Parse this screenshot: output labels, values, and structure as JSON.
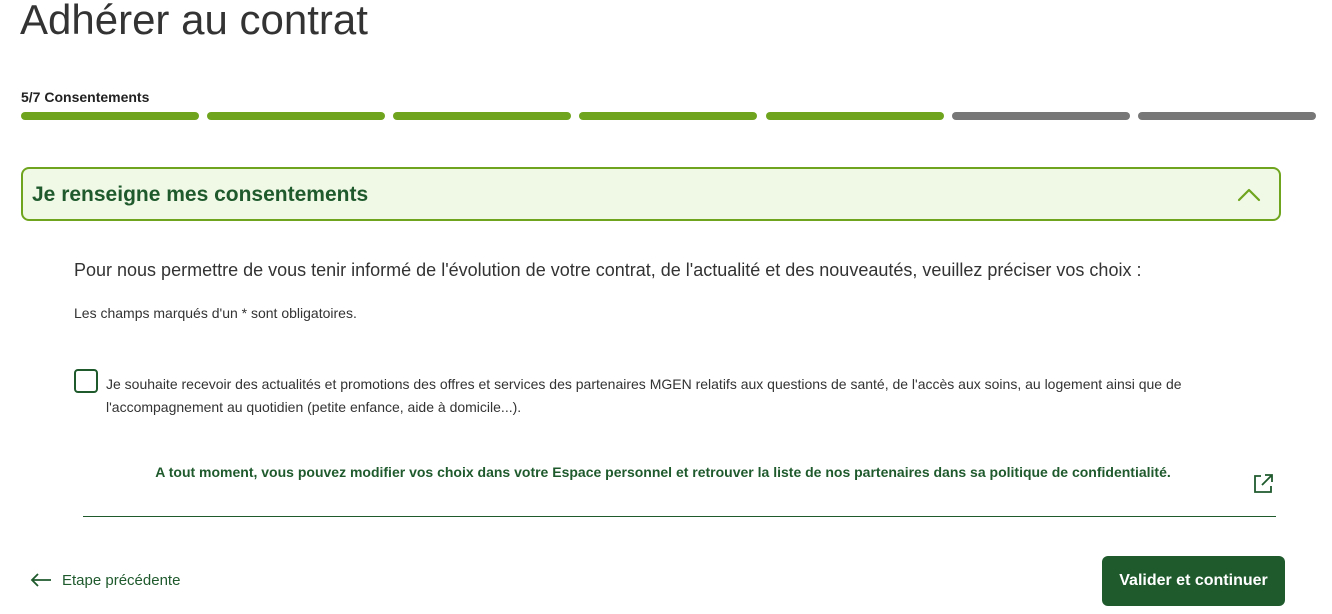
{
  "page": {
    "title": "Adhérer au contrat"
  },
  "progress": {
    "label": "5/7 Consentements",
    "current_step": 5,
    "total_steps": 7,
    "completed_color": "#6fa51e",
    "pending_color": "#777777"
  },
  "section": {
    "title": "Je renseigne mes consentements",
    "expanded": true,
    "toggle_icon": "chevron-up-icon"
  },
  "content": {
    "intro": "Pour nous permettre de vous tenir informé de l'évolution de votre contrat, de l'actualité et des nouveautés, veuillez préciser vos choix :",
    "required_note": "Les champs marqués d'un * sont obligatoires.",
    "consent_checkbox": {
      "checked": false,
      "label": "Je souhaite recevoir des actualités et promotions des offres et services des partenaires MGEN relatifs aux questions de santé, de l'accès aux soins, au logement ainsi que de l'accompagnement au quotidien (petite enfance, aide à domicile...)."
    },
    "notice": "A tout moment, vous pouvez modifier vos choix dans votre Espace personnel et retrouver la liste de nos partenaires dans sa politique de confidentialité.",
    "notice_icon": "external-link-icon"
  },
  "footer": {
    "back_label": "Etape précédente",
    "back_icon": "arrow-left-icon",
    "submit_label": "Valider et continuer"
  },
  "colors": {
    "brand_green": "#1f5a2d",
    "accent_green": "#6fa51e",
    "header_bg": "#f0f8e6"
  }
}
